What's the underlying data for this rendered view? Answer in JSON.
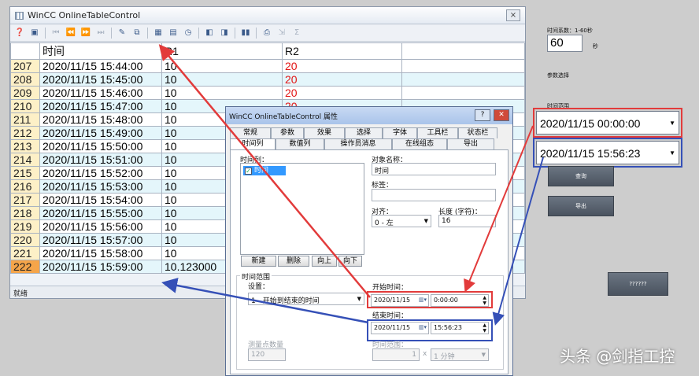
{
  "table_window": {
    "title": "WinCC OnlineTableControl",
    "close_glyph": "⨯",
    "columns": [
      "",
      "时间",
      "R1",
      "R2"
    ],
    "rows": [
      {
        "idx": "207",
        "time": "2020/11/15 15:44:00",
        "r1": "10",
        "r2": "20"
      },
      {
        "idx": "208",
        "time": "2020/11/15 15:45:00",
        "r1": "10",
        "r2": "20"
      },
      {
        "idx": "209",
        "time": "2020/11/15 15:46:00",
        "r1": "10",
        "r2": "20"
      },
      {
        "idx": "210",
        "time": "2020/11/15 15:47:00",
        "r1": "10",
        "r2": "20"
      },
      {
        "idx": "211",
        "time": "2020/11/15 15:48:00",
        "r1": "10",
        "r2": ""
      },
      {
        "idx": "212",
        "time": "2020/11/15 15:49:00",
        "r1": "10",
        "r2": ""
      },
      {
        "idx": "213",
        "time": "2020/11/15 15:50:00",
        "r1": "10",
        "r2": ""
      },
      {
        "idx": "214",
        "time": "2020/11/15 15:51:00",
        "r1": "10",
        "r2": ""
      },
      {
        "idx": "215",
        "time": "2020/11/15 15:52:00",
        "r1": "10",
        "r2": ""
      },
      {
        "idx": "216",
        "time": "2020/11/15 15:53:00",
        "r1": "10",
        "r2": ""
      },
      {
        "idx": "217",
        "time": "2020/11/15 15:54:00",
        "r1": "10",
        "r2": ""
      },
      {
        "idx": "218",
        "time": "2020/11/15 15:55:00",
        "r1": "10",
        "r2": ""
      },
      {
        "idx": "219",
        "time": "2020/11/15 15:56:00",
        "r1": "10",
        "r2": ""
      },
      {
        "idx": "220",
        "time": "2020/11/15 15:57:00",
        "r1": "10",
        "r2": ""
      },
      {
        "idx": "221",
        "time": "2020/11/15 15:58:00",
        "r1": "10",
        "r2": ""
      },
      {
        "idx": "222",
        "time": "2020/11/15 15:59:00",
        "r1": "10.123000",
        "r2": ""
      }
    ],
    "status_text": "就绪"
  },
  "right_panel": {
    "time_coef_label": "时间系数：1-60秒",
    "time_coef_value": "60",
    "seconds_unit": "秒",
    "param_select_label": "参数选择",
    "time_range_label": "时间范围",
    "start_datetime": "2020/11/15 00:00:00",
    "end_datetime": "2020/11/15 15:56:23",
    "query_button": "查询",
    "export_button": "导出",
    "unknown_button": "??????"
  },
  "dialog": {
    "title": "WinCC OnlineTableControl 属性",
    "help_glyph": "?",
    "close_glyph": "✕",
    "tabs_row1": [
      "常规",
      "参数",
      "效果",
      "选择",
      "字体",
      "工具栏",
      "状态栏"
    ],
    "tabs_row2": [
      "时间列",
      "数值列",
      "操作员消息",
      "在线组态",
      "导出"
    ],
    "time_columns_label": "时间列：",
    "time_column_item": "时间",
    "object_name_label": "对象名称：",
    "object_name_value": "时间",
    "tag_label": "标签：",
    "align_label": "对齐：",
    "align_value": "0 - 左",
    "length_label": "长度 (字符)：",
    "length_value": "16",
    "new_button": "新建",
    "delete_button": "删除",
    "up_button": "向上",
    "down_button": "向下",
    "time_range_group": "时间范围",
    "setting_label": "设置：",
    "setting_value": "1 - 开始到结束的时间",
    "start_time_label": "开始时间：",
    "start_date": "2020/11/15",
    "start_time": "0:00:00",
    "end_time_label": "结束时间：",
    "end_date": "2020/11/15",
    "end_time": "15:56:23",
    "points_label": "测量点数量",
    "points_value": "120",
    "range_label": "时间范围：",
    "range_factor": "1",
    "range_x": "x",
    "range_unit": "1 分钟"
  },
  "watermark": "头条 @剑指工控",
  "colors": {
    "red_annotation": "#e23b3b",
    "blue_annotation": "#3550b7",
    "r2_text": "#e21414",
    "selected_index": "#f5a54a"
  }
}
